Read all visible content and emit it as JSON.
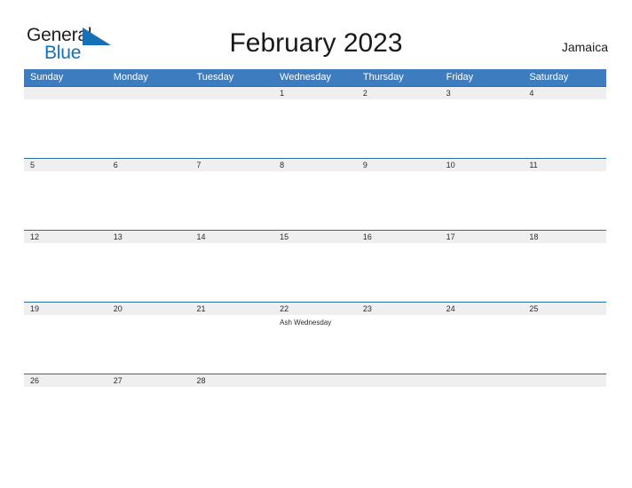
{
  "brand": {
    "name_part1": "General",
    "name_part2": "Blue",
    "flag_icon": "blue-flag-triangle",
    "color_dark": "#231f20",
    "color_blue": "#1470b7"
  },
  "header": {
    "title": "February 2023",
    "country": "Jamaica"
  },
  "colors": {
    "weekday_header_bg": "#3d7cbf",
    "weekday_header_text": "#ffffff",
    "date_band_bg": "#efefef",
    "row_border": "#2e6da4",
    "page_bg": "#ffffff",
    "text": "#2b2b2b"
  },
  "calendar": {
    "weekdays": [
      "Sunday",
      "Monday",
      "Tuesday",
      "Wednesday",
      "Thursday",
      "Friday",
      "Saturday"
    ],
    "weeks": [
      {
        "days": [
          {
            "num": "",
            "event": ""
          },
          {
            "num": "",
            "event": ""
          },
          {
            "num": "",
            "event": ""
          },
          {
            "num": "1",
            "event": ""
          },
          {
            "num": "2",
            "event": ""
          },
          {
            "num": "3",
            "event": ""
          },
          {
            "num": "4",
            "event": ""
          }
        ]
      },
      {
        "days": [
          {
            "num": "5",
            "event": ""
          },
          {
            "num": "6",
            "event": ""
          },
          {
            "num": "7",
            "event": ""
          },
          {
            "num": "8",
            "event": ""
          },
          {
            "num": "9",
            "event": ""
          },
          {
            "num": "10",
            "event": ""
          },
          {
            "num": "11",
            "event": ""
          }
        ]
      },
      {
        "days": [
          {
            "num": "12",
            "event": ""
          },
          {
            "num": "13",
            "event": ""
          },
          {
            "num": "14",
            "event": ""
          },
          {
            "num": "15",
            "event": ""
          },
          {
            "num": "16",
            "event": ""
          },
          {
            "num": "17",
            "event": ""
          },
          {
            "num": "18",
            "event": ""
          }
        ]
      },
      {
        "days": [
          {
            "num": "19",
            "event": ""
          },
          {
            "num": "20",
            "event": ""
          },
          {
            "num": "21",
            "event": ""
          },
          {
            "num": "22",
            "event": "Ash Wednesday"
          },
          {
            "num": "23",
            "event": ""
          },
          {
            "num": "24",
            "event": ""
          },
          {
            "num": "25",
            "event": ""
          }
        ]
      },
      {
        "days": [
          {
            "num": "26",
            "event": ""
          },
          {
            "num": "27",
            "event": ""
          },
          {
            "num": "28",
            "event": ""
          },
          {
            "num": "",
            "event": ""
          },
          {
            "num": "",
            "event": ""
          },
          {
            "num": "",
            "event": ""
          },
          {
            "num": "",
            "event": ""
          }
        ]
      }
    ]
  }
}
